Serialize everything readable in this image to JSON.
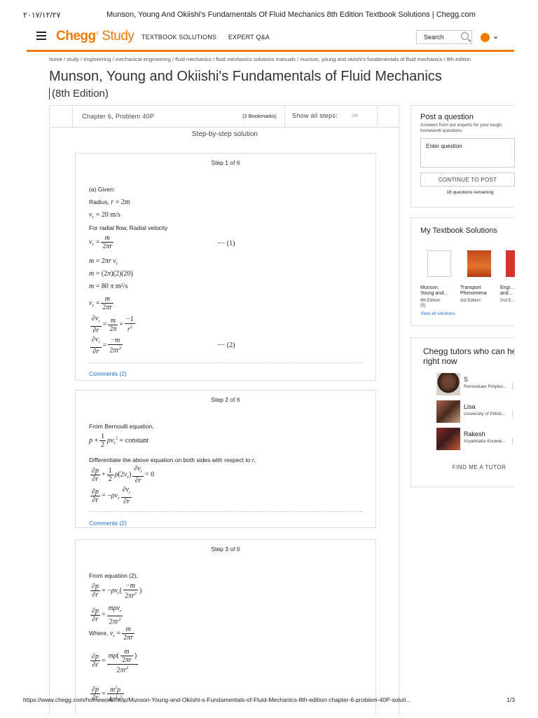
{
  "print_header": {
    "date": "٢٠١٧/١٢/٢٧",
    "title": "Munson, Young And Okiishi's Fundamentals Of Fluid Mechanics 8th Edition Textbook Solutions | Chegg.com"
  },
  "topbar": {
    "logo_brand": "Chegg",
    "logo_product": "Study",
    "nav": [
      "TEXTBOOK SOLUTIONS",
      "EXPERT Q&A"
    ],
    "search_placeholder": "Search",
    "accent": "#ef7a00"
  },
  "breadcrumb": "home / study / engineering / mechanical engineering / fluid mechanics / fluid mechanics solutions manuals / munson, young and okiishi's fundamentals of fluid mechanics / 8th edition",
  "book": {
    "title": "Munson, Young and Okiishi's Fundamentals of Fluid Mechanics",
    "edition": "(8th Edition)"
  },
  "problem_bar": {
    "chapter": "Chapter 6, Problem 40P",
    "bookmarks": "(2 Bookmarks)",
    "show_all": "Show all steps:",
    "toggle": "ON"
  },
  "solution_heading": "Step-by-step solution",
  "steps": [
    {
      "step": "Step 1",
      "of": "of 6",
      "given": "(a) Given:",
      "radius_label": "Radius,",
      "for_radial": "For radial flow, Radial velocity",
      "comments": "Comments (2)"
    },
    {
      "step": "Step 2",
      "of": "of 6",
      "from_bernoulli": "From Bernoulli equation,",
      "differentiate": "Differentiate the above equation on both sides with respect to",
      "comments": "Comments (2)"
    },
    {
      "step": "Step 3",
      "of": "of 6",
      "from_eq2": "From equation (2),",
      "where": "Where,"
    }
  ],
  "post_question": {
    "title": "Post a question",
    "subtitle": "Answers from our experts for your tough homework questions",
    "placeholder": "Enter question",
    "button": "CONTINUE TO POST",
    "remaining": "18 questions remaining"
  },
  "textbook_solutions": {
    "title": "My Textbook Solutions",
    "books": [
      {
        "name": "Munson, Young and...",
        "edition": "8th Edition",
        "extra": "(5)"
      },
      {
        "name": "Transport Phenomena",
        "edition": "3rd Edition",
        "extra": ""
      },
      {
        "name": "Engi... and...",
        "edition": "2nd E...",
        "extra": ""
      }
    ],
    "view_all": "View all solutions"
  },
  "tutors": {
    "title_line1": "Chegg tutors who can help",
    "title_line2": "right now",
    "list": [
      {
        "name": "S",
        "school": "Rensselaer Polytec..."
      },
      {
        "name": "Lisa",
        "school": "University of Pittsb..."
      },
      {
        "name": "Rakesh",
        "school": "Aryabhatta Knowle..."
      }
    ],
    "find_button": "FIND ME A TUTOR"
  },
  "footer": {
    "url": "https://www.chegg.com/homework-help/Munson-Young-and-Okiishi-s-Fundamentals-of-Fluid-Mechanics-8th-edition-chapter-6-problem-40P-soluti...",
    "page": "1/3"
  }
}
